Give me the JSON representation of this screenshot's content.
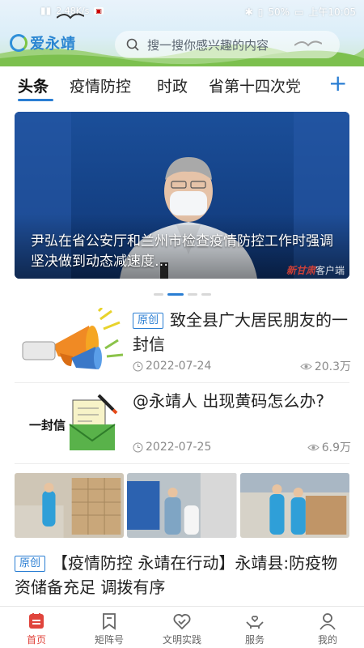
{
  "status_bar": {
    "speed": "2.48K/s",
    "battery": "50%",
    "time": "上午10:05"
  },
  "header": {
    "logo_text": "爱永靖",
    "search_placeholder": "搜一搜你感兴趣的内容"
  },
  "tabs": [
    {
      "label": "头条",
      "active": true
    },
    {
      "label": "疫情防控",
      "active": false
    },
    {
      "label": "时政",
      "active": false
    },
    {
      "label": "省第十四次党",
      "active": false
    }
  ],
  "banner": {
    "caption": "尹弘在省公安厅和兰州市检查疫情防控工作时强调 坚决做到动态减速度…",
    "watermark_brand": "新甘肃",
    "watermark_suffix": "客户端",
    "slides": 4,
    "current_slide": 2
  },
  "news": [
    {
      "tag": "原创",
      "title": "致全县广大居民朋友的一封信",
      "date": "2022-07-24",
      "views": "20.3万",
      "thumb_icon": "megaphone-icon"
    },
    {
      "tag": "",
      "title": "@永靖人 出现黄码怎么办?",
      "date": "2022-07-25",
      "views": "6.9万",
      "thumb_label": "一封信",
      "thumb_icon": "envelope-icon"
    }
  ],
  "feature": {
    "tag": "原创",
    "title": "【疫情防控 永靖在行动】永靖县:防疫物资储备充足 调拨有序"
  },
  "bottom_nav": [
    {
      "label": "首页",
      "icon": "home-icon",
      "active": true
    },
    {
      "label": "矩阵号",
      "icon": "bookmark-icon",
      "active": false
    },
    {
      "label": "文明实践",
      "icon": "heart-icon",
      "active": false
    },
    {
      "label": "服务",
      "icon": "hands-heart-icon",
      "active": false
    },
    {
      "label": "我的",
      "icon": "user-icon",
      "active": false
    }
  ],
  "colors": {
    "accent": "#2a7ed3",
    "nav_active": "#e0443c"
  }
}
